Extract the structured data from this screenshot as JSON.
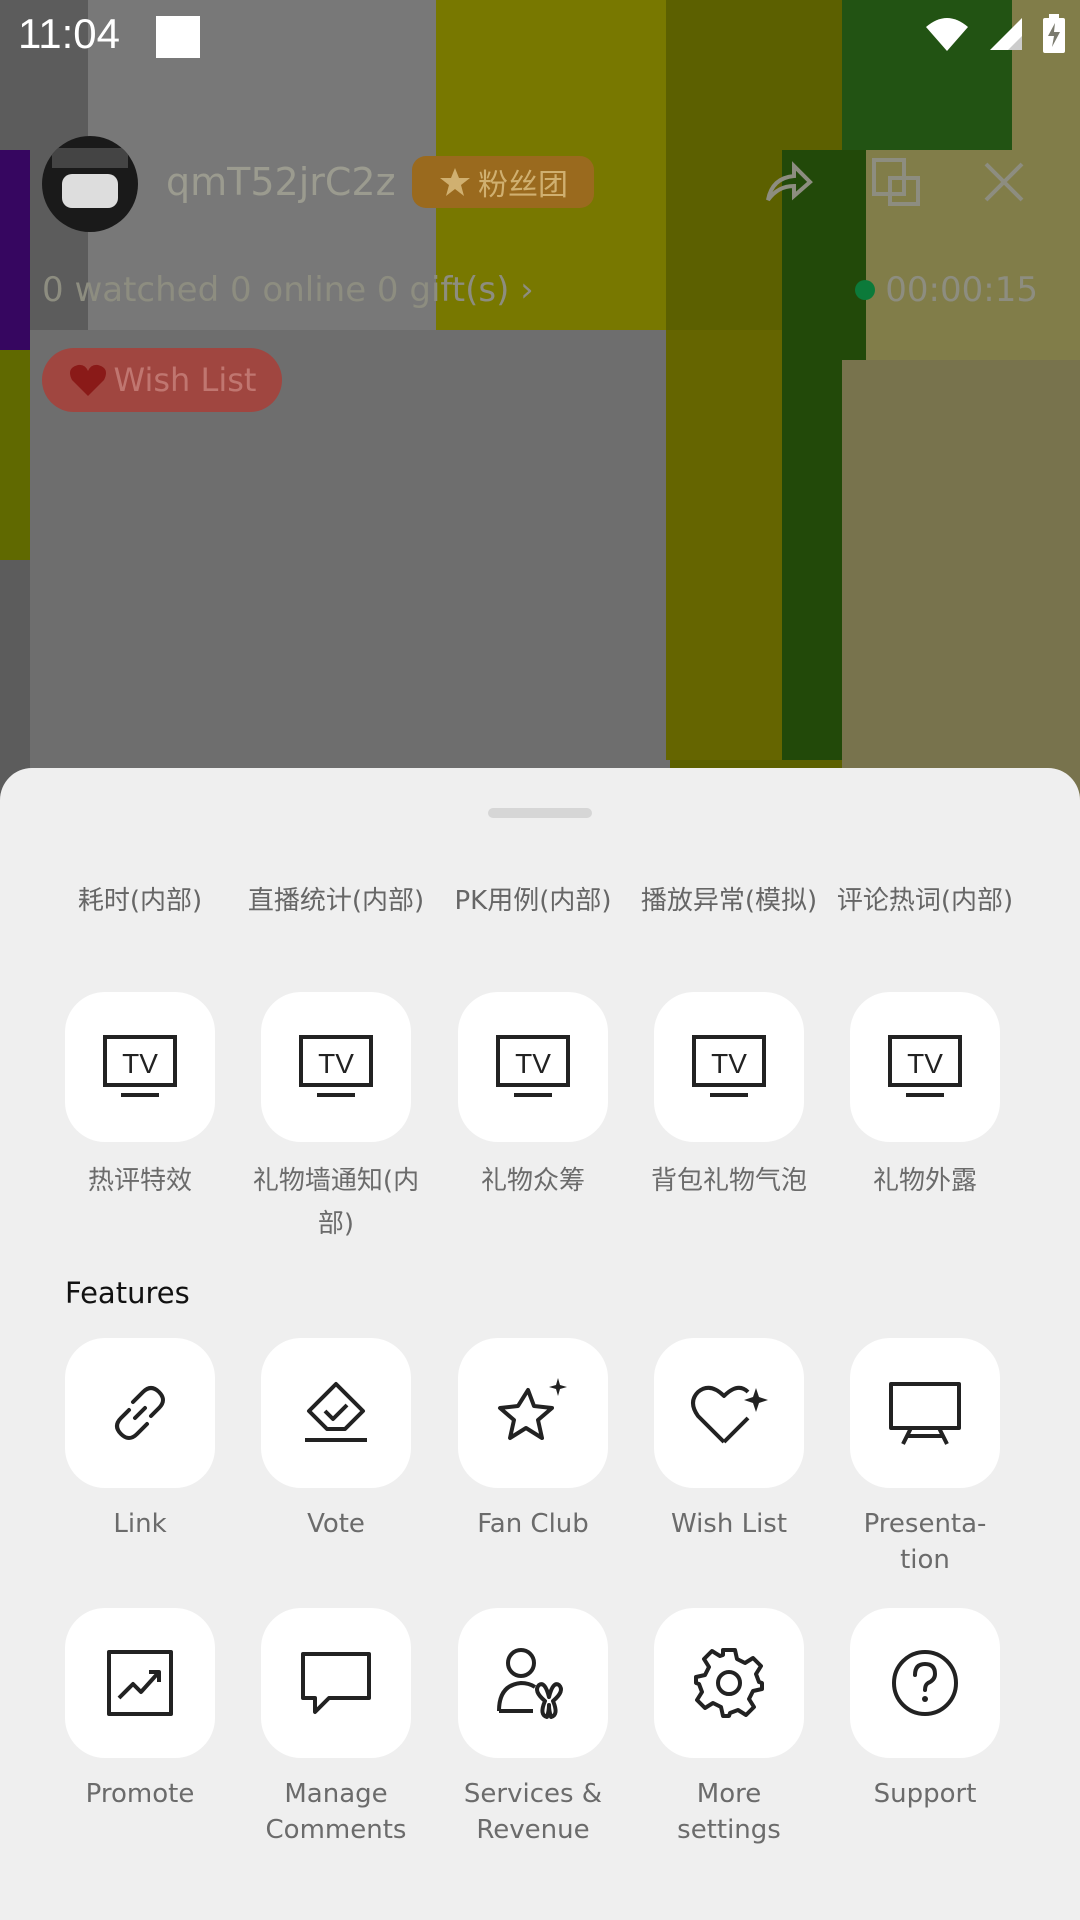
{
  "status_bar": {
    "time": "11:04"
  },
  "live_header": {
    "username": "qmT52jrC2z",
    "fan_badge": "粉丝团",
    "stats": "0 watched   0 online   0 gift(s) ›",
    "timer": "00:00:15",
    "wish_pill": "Wish List",
    "extra": "♡ ·"
  },
  "sheet": {
    "debug_labels": [
      "耗时(内部)",
      "直播统计(内部)",
      "PK用例(内部)",
      "播放异常(模拟)",
      "评论热词(内部)"
    ],
    "tv_items": [
      {
        "label": "热评特效",
        "icon": "tv-icon"
      },
      {
        "label": "礼物墙通知(内部)",
        "icon": "tv-icon"
      },
      {
        "label": "礼物众筹",
        "icon": "tv-icon"
      },
      {
        "label": "背包礼物气泡",
        "icon": "tv-icon"
      },
      {
        "label": "礼物外露",
        "icon": "tv-icon"
      }
    ],
    "tv_icon_text": "TV",
    "features_title": "Features",
    "features_row1": [
      {
        "label": "Link",
        "icon": "link-icon"
      },
      {
        "label": "Vote",
        "icon": "vote-icon"
      },
      {
        "label": "Fan Club",
        "icon": "star-sparkle-icon"
      },
      {
        "label": "Wish List",
        "icon": "heart-sparkle-icon"
      },
      {
        "label": "Presenta-\ntion",
        "icon": "easel-icon"
      }
    ],
    "features_row2": [
      {
        "label": "Promote",
        "icon": "trend-chart-icon"
      },
      {
        "label": "Manage\nComments",
        "icon": "comment-icon"
      },
      {
        "label": "Services &\nRevenue",
        "icon": "person-butterfly-icon"
      },
      {
        "label": "More\nsettings",
        "icon": "gear-icon"
      },
      {
        "label": "Support",
        "icon": "question-icon"
      }
    ]
  }
}
